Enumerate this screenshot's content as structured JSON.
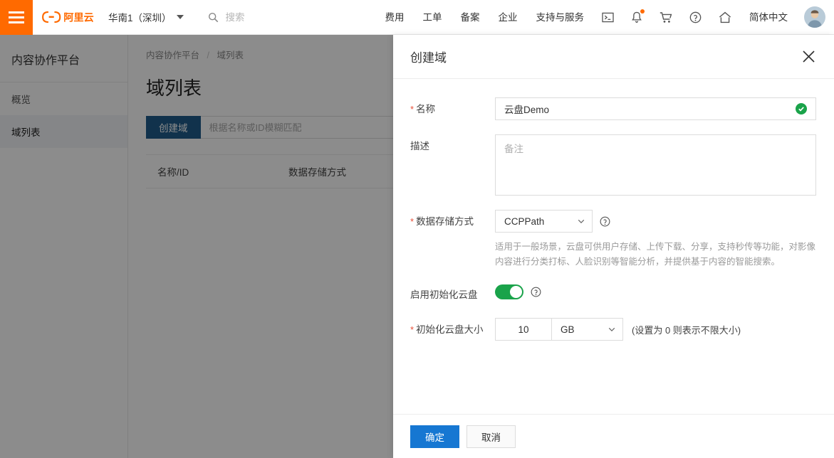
{
  "topnav": {
    "menu_icon": "hamburger-icon",
    "logo_alt": "阿里云",
    "region": "华南1（深圳）",
    "search_placeholder": "搜索",
    "search_value": "",
    "links": [
      "费用",
      "工单",
      "备案",
      "企业",
      "支持与服务"
    ],
    "icons": [
      "terminal-icon",
      "bell-icon",
      "cart-icon",
      "help-icon",
      "home-icon"
    ],
    "language": "简体中文",
    "has_notification_dot": true,
    "accent_color": "#ff6a00"
  },
  "sidebar": {
    "title": "内容协作平台",
    "items": [
      {
        "label": "概览",
        "active": false
      },
      {
        "label": "域列表",
        "active": true
      }
    ]
  },
  "content": {
    "breadcrumb": [
      "内容协作平台",
      "域列表"
    ],
    "breadcrumb_separator": "/",
    "page_title": "域列表",
    "create_button": "创建域",
    "search_placeholder": "根据名称或ID模糊匹配",
    "search_value": "",
    "table_headers": [
      "名称/ID",
      "数据存储方式"
    ],
    "rows": []
  },
  "drawer": {
    "title": "创建域",
    "close_icon": "close-icon",
    "fields": {
      "name": {
        "label": "名称",
        "required": true,
        "value": "云盘Demo",
        "placeholder": "",
        "valid_icon": "check-circle-icon"
      },
      "description": {
        "label": "描述",
        "required": false,
        "value": "",
        "placeholder": "备注"
      },
      "storage": {
        "label": "数据存储方式",
        "required": true,
        "value": "CCPPath",
        "options": [
          "CCPPath"
        ],
        "help_icon": "question-circle-icon",
        "help_text": "适用于一般场景，云盘可供用户存储、上传下载、分享，支持秒传等功能，对影像内容进行分类打标、人脸识别等智能分析，并提供基于内容的智能搜索。"
      },
      "init_drive": {
        "label": "启用初始化云盘",
        "required": false,
        "enabled": true,
        "help_icon": "question-circle-icon"
      },
      "init_size": {
        "label": "初始化云盘大小",
        "required": true,
        "value": "10",
        "unit": "GB",
        "unit_options": [
          "GB"
        ],
        "hint": "(设置为 0 则表示不限大小)"
      }
    },
    "footer": {
      "confirm": "确定",
      "cancel": "取消",
      "primary_color": "#1677d2"
    }
  }
}
